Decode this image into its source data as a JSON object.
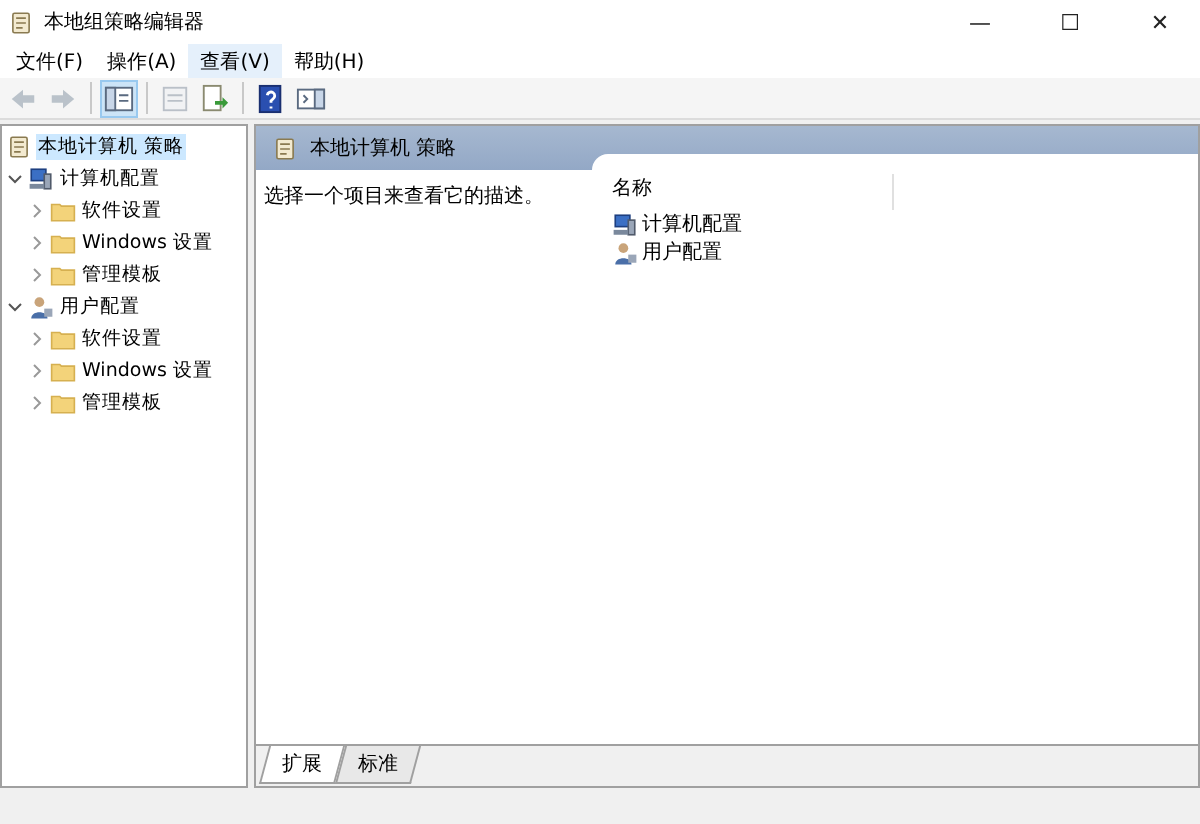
{
  "window": {
    "title": "本地组策略编辑器",
    "controls": [
      "—",
      "☐",
      "✕"
    ]
  },
  "menu": [
    {
      "label": "文件(F)",
      "selected": false
    },
    {
      "label": "操作(A)",
      "selected": false
    },
    {
      "label": "查看(V)",
      "selected": true
    },
    {
      "label": "帮助(H)",
      "selected": false
    }
  ],
  "toolbar": [
    {
      "kind": "back",
      "disabled": true
    },
    {
      "kind": "forward",
      "disabled": true
    },
    {
      "kind": "sep"
    },
    {
      "kind": "tree",
      "selected": true
    },
    {
      "kind": "sep"
    },
    {
      "kind": "props",
      "disabled": true
    },
    {
      "kind": "export",
      "disabled": false
    },
    {
      "kind": "sep"
    },
    {
      "kind": "help",
      "disabled": false
    },
    {
      "kind": "panel",
      "disabled": false
    }
  ],
  "tree": [
    {
      "label": "本地计算机 策略",
      "kind": "policy",
      "selected": true,
      "children": [
        {
          "label": "计算机配置",
          "kind": "computer",
          "selected": false,
          "expanded": true,
          "children": [
            {
              "label": "软件设置",
              "kind": "folder",
              "selected": false,
              "expanded": false
            },
            {
              "label": "Windows 设置",
              "kind": "folder",
              "selected": false,
              "expanded": false
            },
            {
              "label": "管理模板",
              "kind": "folder",
              "selected": false,
              "expanded": false
            }
          ]
        },
        {
          "label": "用户配置",
          "kind": "user",
          "selected": false,
          "expanded": true,
          "children": [
            {
              "label": "软件设置",
              "kind": "folder",
              "selected": false,
              "expanded": false
            },
            {
              "label": "Windows 设置",
              "kind": "folder",
              "selected": false,
              "expanded": false
            },
            {
              "label": "管理模板",
              "kind": "folder",
              "selected": false,
              "expanded": false
            }
          ]
        }
      ]
    }
  ],
  "details": {
    "title": "本地计算机 策略",
    "description": "选择一个项目来查看它的描述。",
    "columns": [
      "名称"
    ],
    "items": [
      {
        "label": "计算机配置",
        "kind": "computer"
      },
      {
        "label": "用户配置",
        "kind": "user"
      }
    ]
  },
  "tabs": [
    {
      "label": "扩展",
      "selected": true
    },
    {
      "label": "标准",
      "selected": false
    }
  ]
}
